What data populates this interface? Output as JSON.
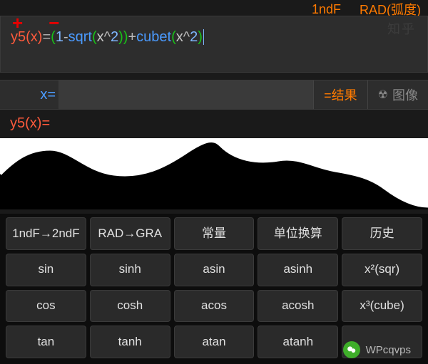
{
  "top": {
    "mode": "1ndF",
    "angle": "RAD(弧度)"
  },
  "formula": {
    "name": "y5(x)",
    "eq": "=",
    "tokens": {
      "open": "(",
      "n1": "1",
      "minus": "-",
      "sqrt": "sqrt",
      "open2": "(",
      "x1": "x",
      "pow1": "^",
      "n2": "2",
      "close2": ")",
      "close": ")",
      "plus": "+",
      "cubet": "cubet",
      "open3": "(",
      "x2": "x",
      "pow2": "^",
      "n3": "2",
      "close3": ")"
    },
    "watermark": "知乎"
  },
  "xrow": {
    "label": "x=",
    "value": "",
    "placeholder": "",
    "result_btn": "=结果",
    "image_btn": "图像"
  },
  "result": {
    "label": "y5(x)="
  },
  "keys": [
    "1ndF→2ndF",
    "RAD→GRA",
    "常量",
    "单位换算",
    "历史",
    "sin",
    "sinh",
    "asin",
    "asinh",
    "x²(sqr)",
    "cos",
    "cosh",
    "acos",
    "acosh",
    "x³(cube)",
    "tan",
    "tanh",
    "atan",
    "atanh",
    ""
  ],
  "footer_wm": "WPcqvps"
}
